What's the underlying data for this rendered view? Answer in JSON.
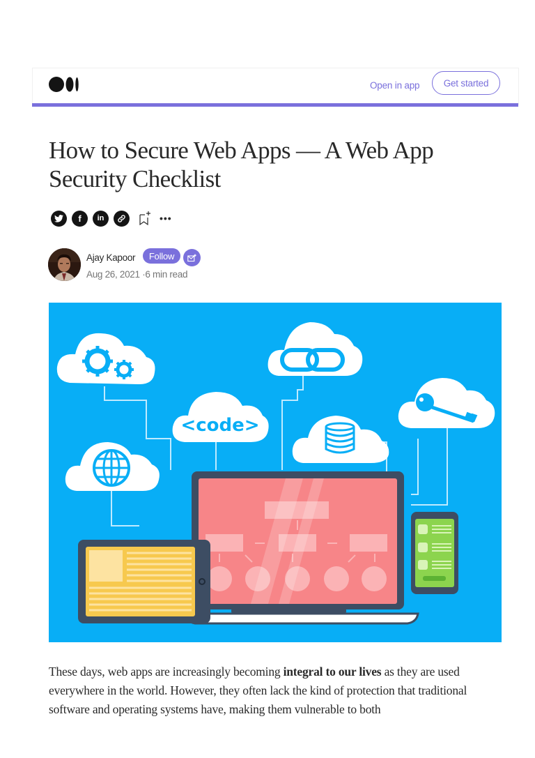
{
  "header": {
    "logo": "medium-logo",
    "open_in_app": "Open in app",
    "get_started": "Get started",
    "accent_color": "#7a70dc"
  },
  "article": {
    "title": "How to Secure Web Apps — A Web App Security Checklist",
    "share": {
      "icons": [
        "twitter-icon",
        "facebook-icon",
        "linkedin-icon",
        "link-icon"
      ],
      "twitter_glyph": "t",
      "facebook_glyph": "f",
      "linkedin_glyph": "in",
      "bookmark_icon": "bookmark-add-icon",
      "more_icon": "more-icon",
      "more_glyph": "•••"
    },
    "author": {
      "name": "Ajay Kapoor",
      "follow_label": "Follow",
      "subscribe_icon": "email-subscribe-icon",
      "date": "Aug 26, 2021",
      "separator": "·",
      "read_time": "6 min read"
    },
    "hero_image": {
      "description": "Web app security illustration: clouds with gears, code, link, database, globe and key icons above a laptop, tablet and phone",
      "code_label": "<code>",
      "background_color": "#08aef6"
    },
    "body": {
      "para1_before": "These days, web apps are increasingly becoming ",
      "para1_bold": "integral to our lives",
      "para1_after": " as they are used everywhere in the world. However, they often lack the kind of protection that traditional software and operating systems have, making them vulnerable to both"
    }
  }
}
